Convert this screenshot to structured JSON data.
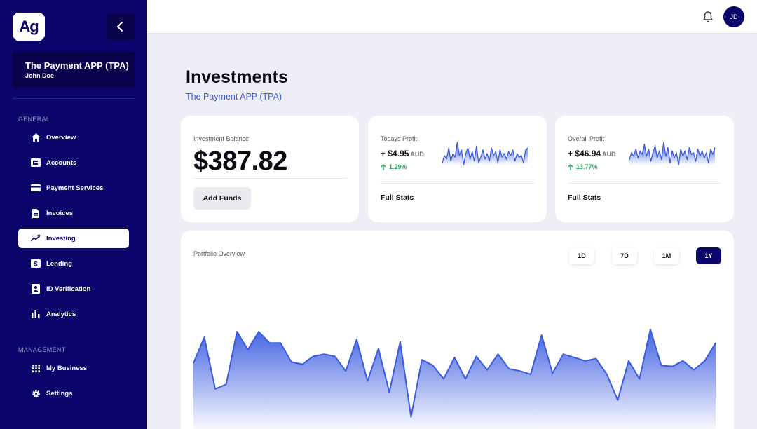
{
  "sidebar": {
    "logo_text": "Ag",
    "app_name": "The Payment APP (TPA)",
    "user_name": "John Doe",
    "general_label": "GENERAL",
    "management_label": "MANAGEMENT",
    "items": [
      {
        "label": "Overview",
        "icon": "home-icon"
      },
      {
        "label": "Accounts",
        "icon": "accounts-icon"
      },
      {
        "label": "Payment Services",
        "icon": "card-icon"
      },
      {
        "label": "Invoices",
        "icon": "document-icon"
      },
      {
        "label": "Investing",
        "icon": "trend-icon",
        "active": true
      },
      {
        "label": "Lending",
        "icon": "dollar-icon"
      },
      {
        "label": "ID Verification",
        "icon": "id-card-icon"
      },
      {
        "label": "Analytics",
        "icon": "bar-chart-icon"
      }
    ],
    "management_items": [
      {
        "label": "My Business",
        "icon": "grid-icon"
      },
      {
        "label": "Settings",
        "icon": "gear-icon"
      }
    ]
  },
  "topbar": {
    "avatar_initials": "JD",
    "bell_icon": "bell-icon"
  },
  "page": {
    "title": "Investments",
    "subtitle": "The Payment APP (TPA)"
  },
  "balance_card": {
    "label": "Investment Balance",
    "amount": "$387.82",
    "button": "Add Funds"
  },
  "today_card": {
    "label": "Todays Profit",
    "amount": "+ $4.95",
    "currency": "AUD",
    "change": "1.29%",
    "link": "Full Stats",
    "spark": [
      5,
      9,
      7,
      13,
      6,
      10,
      8,
      16,
      9,
      12,
      4,
      10,
      13,
      7,
      11,
      6,
      14,
      5,
      8,
      12,
      7,
      10,
      6,
      13,
      9,
      11,
      5,
      12,
      8,
      10,
      7,
      11,
      9,
      12,
      6,
      10,
      8,
      9,
      5,
      12,
      13
    ]
  },
  "overall_card": {
    "label": "Overall Profit",
    "amount": "+ $46.94",
    "currency": "AUD",
    "change": "13.77%",
    "link": "Full Stats",
    "spark": [
      6,
      10,
      8,
      12,
      7,
      11,
      9,
      15,
      8,
      12,
      5,
      10,
      14,
      7,
      11,
      6,
      16,
      8,
      13,
      4,
      11,
      7,
      10,
      3,
      12,
      8,
      11,
      6,
      13,
      9,
      10,
      5,
      12,
      8,
      11,
      7,
      10,
      4,
      12,
      9,
      13
    ]
  },
  "portfolio": {
    "label": "Portfolio Overview",
    "ranges": [
      "1D",
      "7D",
      "1M",
      "1Y"
    ],
    "active_range": "1Y"
  },
  "colors": {
    "primary": "#0c056b",
    "accent": "#3a5be0",
    "positive": "#1eaa5a",
    "background": "#eeeef6"
  },
  "chart_data": {
    "type": "area",
    "title": "Portfolio Overview",
    "xlabel": "",
    "ylabel": "",
    "values": [
      60,
      83,
      37,
      41,
      88,
      72,
      88,
      78,
      78,
      61,
      59,
      66,
      68,
      66,
      53,
      81,
      44,
      73,
      34,
      79,
      12,
      63,
      58,
      46,
      65,
      46,
      66,
      54,
      68,
      55,
      53,
      50,
      85,
      51,
      68,
      65,
      62,
      64,
      50,
      27,
      62,
      46,
      90,
      58,
      57,
      62,
      54,
      62,
      78
    ],
    "ylim": [
      0,
      100
    ]
  }
}
